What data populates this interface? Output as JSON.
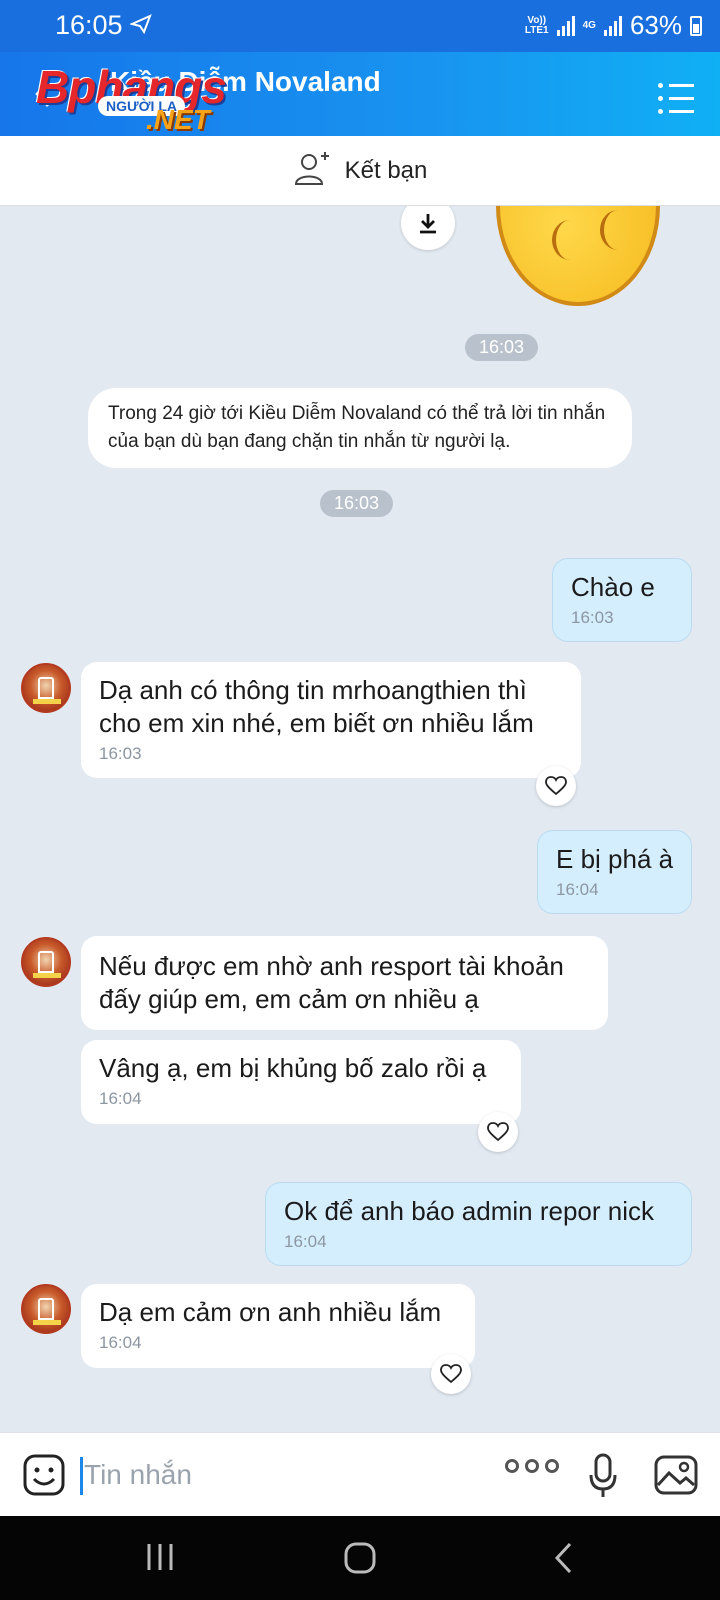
{
  "status_bar": {
    "time": "16:05",
    "volte_top": "Vo))",
    "volte_bottom": "LTE1",
    "net": "4G",
    "battery": "63%"
  },
  "header": {
    "title": "Kiều Diễm Novaland",
    "logo": {
      "brand": "Bphangs",
      "badge": "NGƯỜI LẠ",
      "net": ".NET"
    }
  },
  "friend_bar": {
    "label": "Kết bạn"
  },
  "chat": {
    "timestamp_1": "16:03",
    "notice": "Trong 24 giờ tới Kiều Diễm Novaland có thể trả lời tin nhắn của bạn dù bạn đang chặn tin nhắn từ người lạ.",
    "timestamp_2": "16:03",
    "messages": [
      {
        "sender": "me",
        "lines": [
          "Chào e"
        ],
        "time": "16:03"
      },
      {
        "sender": "them",
        "lines": [
          "Dạ anh có thông tin mrhoangthien thì",
          "cho em xin nhé, em biết ơn nhiều lắm"
        ],
        "time": "16:03"
      },
      {
        "sender": "me",
        "lines": [
          "E bị phá à"
        ],
        "time": "16:04"
      },
      {
        "sender": "them",
        "lines": [
          "Nếu được em nhờ anh resport tài khoản",
          "đấy giúp em, em cảm ơn nhiều ạ"
        ],
        "time": ""
      },
      {
        "sender": "them",
        "lines": [
          "Vâng ạ, em bị khủng bố zalo rồi ạ"
        ],
        "time": "16:04"
      },
      {
        "sender": "me",
        "lines": [
          "Ok để anh báo admin repor nick"
        ],
        "time": "16:04"
      },
      {
        "sender": "them",
        "lines": [
          "Dạ em cảm ơn anh nhiều lắm"
        ],
        "time": "16:04"
      }
    ]
  },
  "input": {
    "placeholder": "Tin nhắn"
  },
  "colors": {
    "header": "#1894f0",
    "my_bubble": "#d5eefe",
    "background": "#e2e9f1"
  }
}
